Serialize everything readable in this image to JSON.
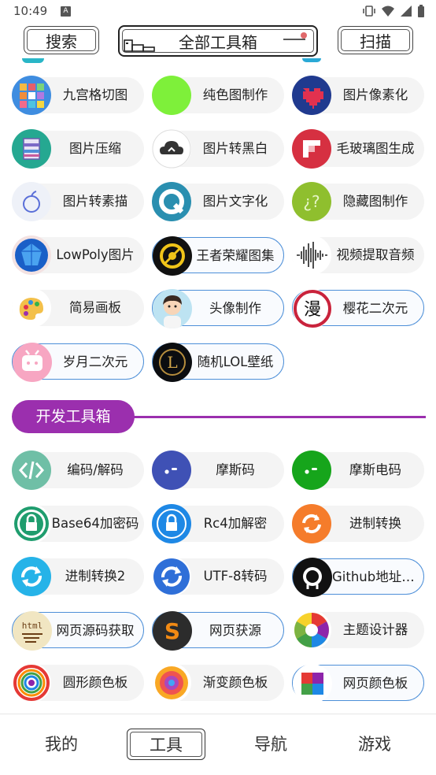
{
  "status_bar": {
    "time": "10:49",
    "badge": "A"
  },
  "header": {
    "search_label": "搜索",
    "title": "全部工具箱",
    "scan_label": "扫描"
  },
  "image_tools": [
    {
      "label": "九宫格切图",
      "icon": "grid-photos-icon",
      "outlined": false
    },
    {
      "label": "纯色图制作",
      "icon": "green-circle-icon",
      "outlined": false
    },
    {
      "label": "图片像素化",
      "icon": "pixel-heart-icon",
      "outlined": false
    },
    {
      "label": "图片压缩",
      "icon": "archive-icon",
      "outlined": false
    },
    {
      "label": "图片转黑白",
      "icon": "cloud-icon",
      "outlined": false
    },
    {
      "label": "毛玻璃图生成",
      "icon": "flipboard-icon",
      "outlined": false
    },
    {
      "label": "图片转素描",
      "icon": "sketch-apple-icon",
      "outlined": false
    },
    {
      "label": "图片文字化",
      "icon": "q-letter-icon",
      "outlined": false
    },
    {
      "label": "隐藏图制作",
      "icon": "question-bubble-icon",
      "outlined": false
    },
    {
      "label": "LowPoly图片",
      "icon": "gem-icon",
      "outlined": false
    },
    {
      "label": "王者荣耀图集",
      "icon": "target-icon",
      "outlined": true
    },
    {
      "label": "视频提取音频",
      "icon": "waveform-icon",
      "outlined": false
    },
    {
      "label": "简易画板",
      "icon": "palette-icon",
      "outlined": false
    },
    {
      "label": "头像制作",
      "icon": "avatar-boy-icon",
      "outlined": true
    },
    {
      "label": "樱花二次元",
      "icon": "manga-icon",
      "outlined": true
    },
    {
      "label": "岁月二次元",
      "icon": "bilibili-icon",
      "outlined": true
    },
    {
      "label": "随机LOL壁纸",
      "icon": "lol-icon",
      "outlined": true
    }
  ],
  "section": {
    "title": "开发工具箱"
  },
  "dev_tools": [
    {
      "label": "编码/解码",
      "icon": "code-brackets-icon",
      "outlined": false
    },
    {
      "label": "摩斯码",
      "icon": "morse-icon",
      "outlined": false
    },
    {
      "label": "摩斯电码",
      "icon": "morse-green-icon",
      "outlined": false
    },
    {
      "label": "Base64加密码",
      "icon": "lock-icon",
      "outlined": false
    },
    {
      "label": "Rc4加解密",
      "icon": "padlock-icon",
      "outlined": false
    },
    {
      "label": "进制转换",
      "icon": "refresh-icon",
      "outlined": false
    },
    {
      "label": "进制转换2",
      "icon": "sync-icon",
      "outlined": false
    },
    {
      "label": "UTF-8转码",
      "icon": "sync-blue-icon",
      "outlined": false
    },
    {
      "label": "Github地址解...",
      "icon": "github-icon",
      "outlined": true
    },
    {
      "label": "网页源码获取",
      "icon": "html-icon",
      "outlined": true
    },
    {
      "label": "网页获源",
      "icon": "sublime-icon",
      "outlined": true
    },
    {
      "label": "主题设计器",
      "icon": "color-wheel-icon",
      "outlined": false
    },
    {
      "label": "圆形颜色板",
      "icon": "color-circle-icon",
      "outlined": false
    },
    {
      "label": "渐变颜色板",
      "icon": "gradient-icon",
      "outlined": false
    },
    {
      "label": "网页颜色板",
      "icon": "color-square-icon",
      "outlined": true
    }
  ],
  "bottom_nav": [
    {
      "label": "我的",
      "active": false
    },
    {
      "label": "工具",
      "active": true
    },
    {
      "label": "导航",
      "active": false
    },
    {
      "label": "游戏",
      "active": false
    }
  ],
  "colors": {
    "accent": "#9b2fae",
    "outline": "#4d8fd8",
    "pill_bg": "#f4f4f4"
  }
}
